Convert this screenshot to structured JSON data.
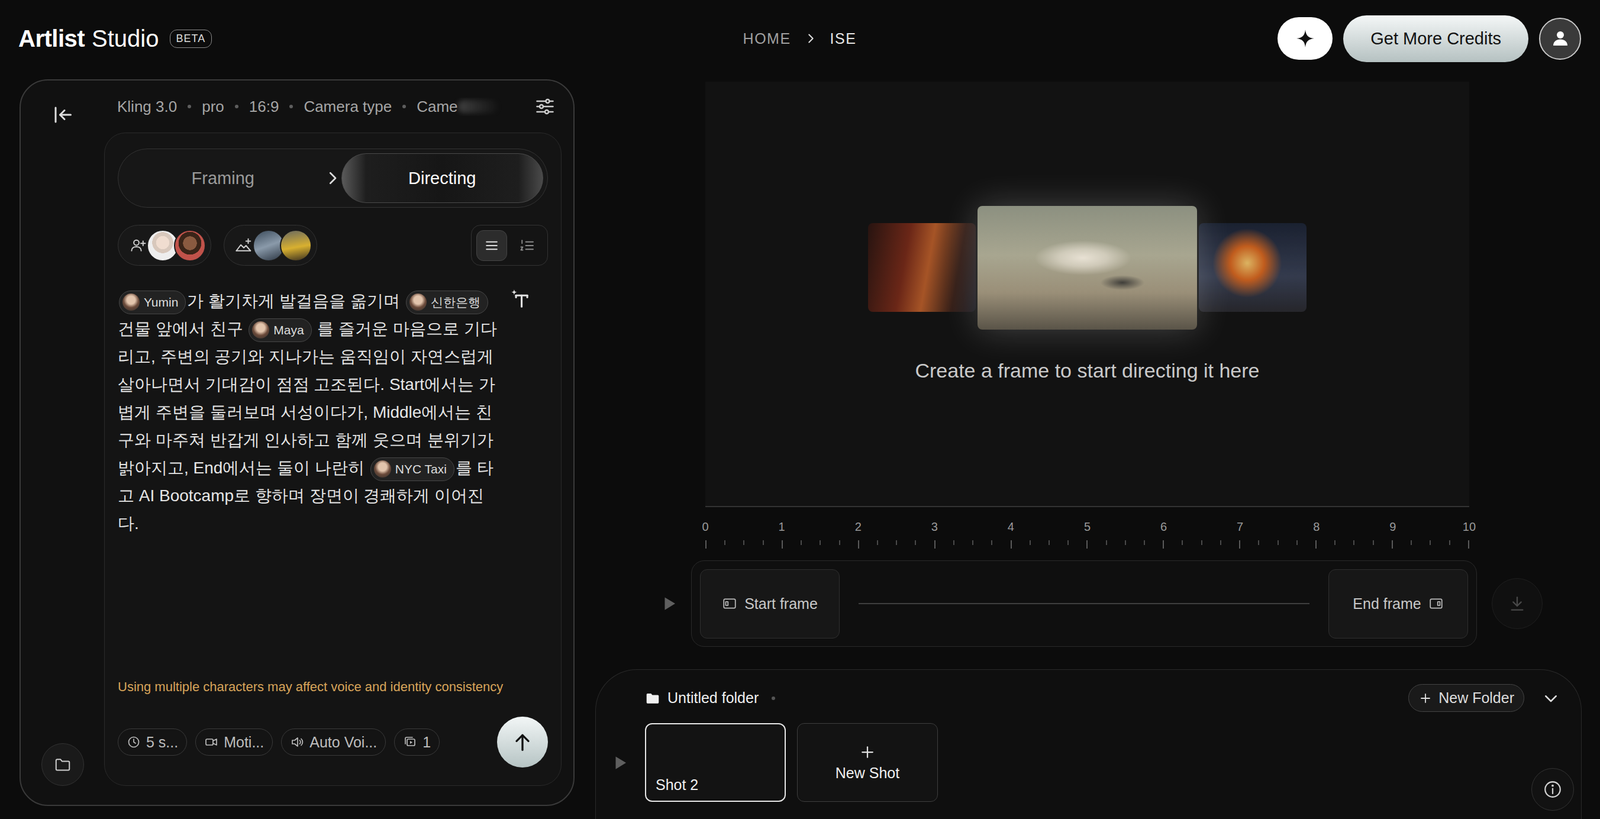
{
  "brand": {
    "name": "Artlist",
    "product": "Studio",
    "badge": "BETA"
  },
  "breadcrumb": [
    {
      "label": "HOME",
      "selected": false
    },
    {
      "label": "ISE",
      "selected": true
    }
  ],
  "top_actions": {
    "credits": "Get More Credits"
  },
  "settings": {
    "items": [
      "Kling 3.0",
      "pro",
      "16:9",
      "Camera type",
      "Came"
    ]
  },
  "mode_tabs": [
    {
      "label": "Framing",
      "selected": false
    },
    {
      "label": "Directing",
      "selected": true
    }
  ],
  "asset_groups": [
    {
      "kind": "character"
    },
    {
      "kind": "location"
    }
  ],
  "view_toggle": [
    {
      "kind": "paragraph",
      "selected": true
    },
    {
      "kind": "numbered",
      "selected": false
    }
  ],
  "prompt": {
    "segments": [
      {
        "kind": "mention",
        "text": "Yumin"
      },
      {
        "kind": "text",
        "text": "가 활기차게 발걸음을 옮기며 "
      },
      {
        "kind": "mention",
        "text": "신한은행"
      },
      {
        "kind": "text",
        "text": " 건물 앞에서 친구 "
      },
      {
        "kind": "mention",
        "text": "Maya"
      },
      {
        "kind": "text",
        "text": " 를 즐거운 마음으로 기다리고, 주변의 공기와 지나가는 움직임이 자연스럽게 살아나면서 기대감이 점점 고조된다. Start에서는 가볍게 주변을 둘러보며 서성이다가, Middle에서는 친구와 마주쳐 반갑게 인사하고 함께 웃으며 분위기가 밝아지고, End에서는 둘이 나란히 "
      },
      {
        "kind": "mention",
        "text": "NYC Taxi"
      },
      {
        "kind": "text",
        "text": "를 타고 AI Bootcamp로 향하며 장면이 경쾌하게 이어진다."
      }
    ]
  },
  "warning": "Using multiple characters may affect voice and identity consistency",
  "options": [
    {
      "kind": "duration",
      "label": "5 s..."
    },
    {
      "kind": "motion",
      "label": "Moti..."
    },
    {
      "kind": "voice",
      "label": "Auto Voi..."
    },
    {
      "kind": "count",
      "label": "1"
    }
  ],
  "preview": {
    "message": "Create a frame to start directing it here"
  },
  "ruler": [
    "0",
    "1",
    "2",
    "3",
    "4",
    "5",
    "6",
    "7",
    "8",
    "9",
    "10"
  ],
  "timeline": {
    "start": "Start frame",
    "end": "End frame",
    "download_disabled": true
  },
  "folder": {
    "name": "Untitled folder",
    "new_folder": "New Folder"
  },
  "shots": [
    {
      "label": "Shot 2",
      "kind": "shot",
      "selected": true
    },
    {
      "label": "New Shot",
      "kind": "new",
      "selected": false
    }
  ]
}
